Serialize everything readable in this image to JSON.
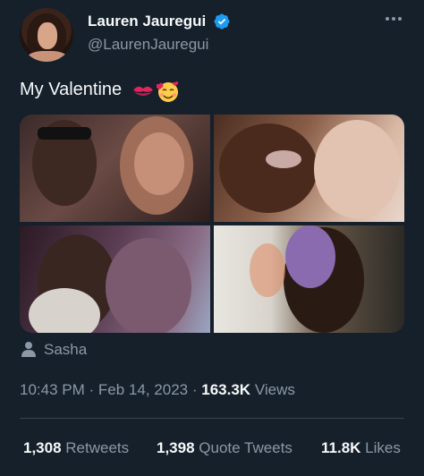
{
  "author": {
    "name": "Lauren Jauregui",
    "handle": "@LaurenJauregui",
    "verified": true,
    "avatar_icon": "profile-photo"
  },
  "tweet": {
    "text": "My Valentine",
    "emojis": [
      "kiss-mark-emoji",
      "smiling-face-with-hearts-emoji"
    ]
  },
  "media": {
    "photo_count": 4
  },
  "tagged_user": {
    "icon": "person-icon",
    "name": "Sasha"
  },
  "meta": {
    "time": "10:43 PM",
    "separator": "·",
    "date": "Feb 14, 2023",
    "views_count": "163.3K",
    "views_label": "Views"
  },
  "stats": {
    "retweets_count": "1,308",
    "retweets_label": "Retweets",
    "quotes_count": "1,398",
    "quotes_label": "Quote Tweets",
    "likes_count": "11.8K",
    "likes_label": "Likes"
  },
  "colors": {
    "background": "#15202b",
    "text_primary": "#f7f9f9",
    "text_secondary": "#8b98a5",
    "verified_blue": "#1d9bf0",
    "divider": "#38444d"
  }
}
